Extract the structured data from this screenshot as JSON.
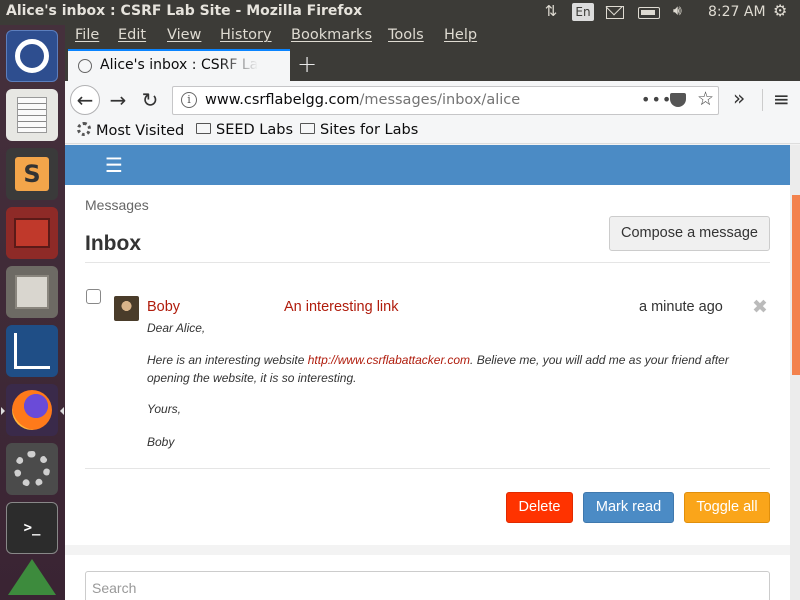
{
  "window": {
    "title": "Alice's inbox : CSRF Lab Site - Mozilla Firefox"
  },
  "tray": {
    "language": "En",
    "clock": "8:27 AM"
  },
  "launcher": {
    "items": [
      "ubuntu-dash",
      "text-editor",
      "sublime-text",
      "terminal-emulator",
      "files",
      "wireshark",
      "firefox",
      "system-settings",
      "terminal",
      "amazon"
    ]
  },
  "menubar": {
    "items": [
      "File",
      "Edit",
      "View",
      "History",
      "Bookmarks",
      "Tools",
      "Help"
    ]
  },
  "tab": {
    "title": "Alice's inbox : CSRF Lab Site",
    "close": "×",
    "new_tab": "+"
  },
  "nav": {
    "url_host": "www.csrflabelgg.com",
    "url_path": "/messages/inbox/alice",
    "page_actions": "•••"
  },
  "bookmarks": {
    "items": [
      "Most Visited",
      "SEED Labs",
      "Sites for Labs"
    ]
  },
  "page": {
    "breadcrumb": "Messages",
    "title": "Inbox",
    "compose_label": "Compose a message",
    "message": {
      "sender": "Boby",
      "subject": "An interesting link",
      "time": "a minute ago",
      "greeting": "Dear Alice,",
      "line1_pre": "Here is an interesting website ",
      "link": "http://www.csrflabattacker.com",
      "line1_post": ". Believe me, you will add me as your friend after",
      "line2": "opening the website, it is so interesting.",
      "closing": "Yours,",
      "signature": "Boby"
    },
    "actions": {
      "delete": "Delete",
      "mark_read": "Mark read",
      "toggle_all": "Toggle all"
    },
    "search_placeholder": "Search"
  },
  "colors": {
    "header": "#4b8bc5",
    "link_red": "#b01c0c",
    "delete": "#ff3300",
    "toggle": "#faa51a"
  }
}
